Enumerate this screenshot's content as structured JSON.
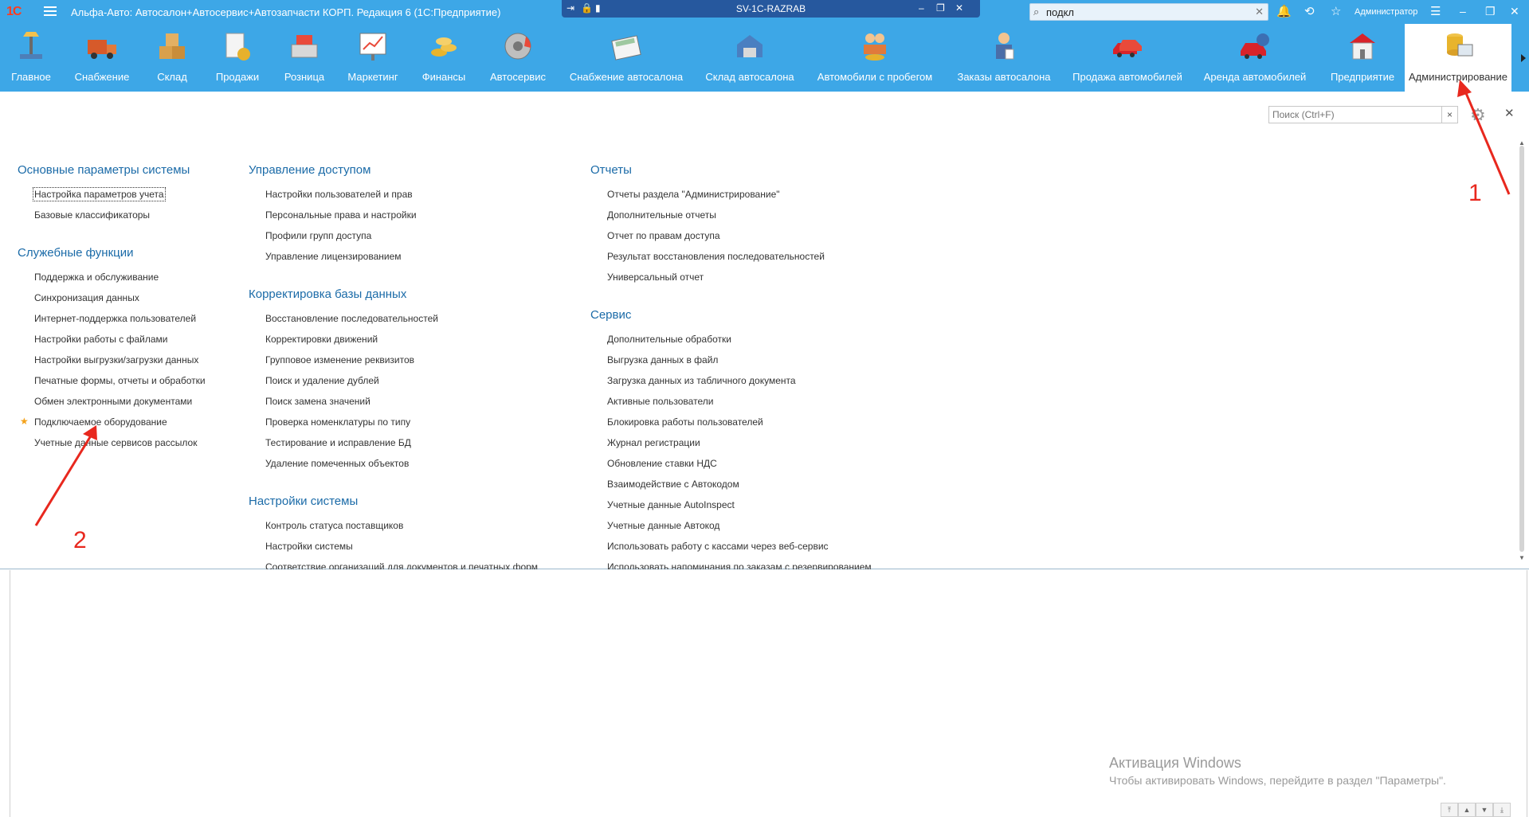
{
  "window": {
    "title": "Альфа-Авто: Автосалон+Автосервис+Автозапчасти КОРП. Редакция 6  (1С:Предприятие)",
    "remote_host": "SV-1C-RAZRAB",
    "search_value": "подкл",
    "user": "Администратор"
  },
  "sections": [
    {
      "label": "Главное",
      "icon": "desk-lamp-icon"
    },
    {
      "label": "Снабжение",
      "icon": "truck-icon"
    },
    {
      "label": "Склад",
      "icon": "boxes-icon"
    },
    {
      "label": "Продажи",
      "icon": "sales-docs-icon"
    },
    {
      "label": "Розница",
      "icon": "cash-register-icon"
    },
    {
      "label": "Маркетинг",
      "icon": "chart-board-icon"
    },
    {
      "label": "Финансы",
      "icon": "coins-icon"
    },
    {
      "label": "Автосервис",
      "icon": "brake-disc-icon"
    },
    {
      "label": "Снабжение автосалона",
      "icon": "calculator-icon"
    },
    {
      "label": "Склад автосалона",
      "icon": "garage-icon"
    },
    {
      "label": "Автомобили с пробегом",
      "icon": "handshake-icon"
    },
    {
      "label": "Заказы автосалона",
      "icon": "manager-icon"
    },
    {
      "label": "Продажа автомобилей",
      "icon": "red-cars-icon"
    },
    {
      "label": "Аренда автомобилей",
      "icon": "car-rent-icon"
    },
    {
      "label": "Предприятие",
      "icon": "building-icon"
    },
    {
      "label": "Администрирование",
      "icon": "database-computer-icon"
    }
  ],
  "panel": {
    "search_placeholder": "Поиск (Ctrl+F)",
    "groups": [
      {
        "title": "Основные параметры системы",
        "items": [
          "Настройка параметров учета",
          "Базовые классификаторы"
        ]
      },
      {
        "title": "Служебные функции",
        "items": [
          "Поддержка и обслуживание",
          "Синхронизация данных",
          "Интернет-поддержка пользователей",
          "Настройки работы с файлами",
          "Настройки выгрузки/загрузки данных",
          "Печатные формы, отчеты и обработки",
          "Обмен электронными документами",
          "Подключаемое оборудование",
          "Учетные данные сервисов рассылок"
        ]
      },
      {
        "title": "Управление доступом",
        "items": [
          "Настройки пользователей и прав",
          "Персональные права и настройки",
          "Профили групп доступа",
          "Управление лицензированием"
        ]
      },
      {
        "title": "Корректировка базы данных",
        "items": [
          "Восстановление последовательностей",
          "Корректировки движений",
          "Групповое изменение реквизитов",
          "Поиск и удаление дублей",
          "Поиск замена значений",
          "Проверка номенклатуры по типу",
          "Тестирование и исправление БД",
          "Удаление помеченных объектов"
        ]
      },
      {
        "title": "Настройки системы",
        "items": [
          "Контроль статуса поставщиков",
          "Настройки системы",
          "Соответствие организаций для документов и печатных форм"
        ]
      },
      {
        "title": "Отчеты",
        "items": [
          "Отчеты раздела \"Администрирование\"",
          "Дополнительные отчеты",
          "Отчет по правам доступа",
          "Результат восстановления последовательностей",
          "Универсальный отчет"
        ]
      },
      {
        "title": "Сервис",
        "items": [
          "Дополнительные обработки",
          "Выгрузка данных в файл",
          "Загрузка данных из табличного документа",
          "Активные пользователи",
          "Блокировка работы пользователей",
          "Журнал регистрации",
          "Обновление ставки НДС",
          "Взаимодействие с Автокодом",
          "Учетные данные AutoInspect",
          "Учетные данные Автокод",
          "Использовать работу с кассами через веб-сервис",
          "Использовать напоминания по заказам с резервированием"
        ]
      }
    ]
  },
  "watermark": {
    "title": "Активация Windows",
    "subtitle": "Чтобы активировать Windows, перейдите в раздел \"Параметры\"."
  },
  "annotations": {
    "first": "1",
    "second": "2",
    "color": "#e8281e"
  },
  "colors": {
    "accent": "#3da7e7",
    "link": "#1b6ba8",
    "remote_bar": "#26589e"
  }
}
